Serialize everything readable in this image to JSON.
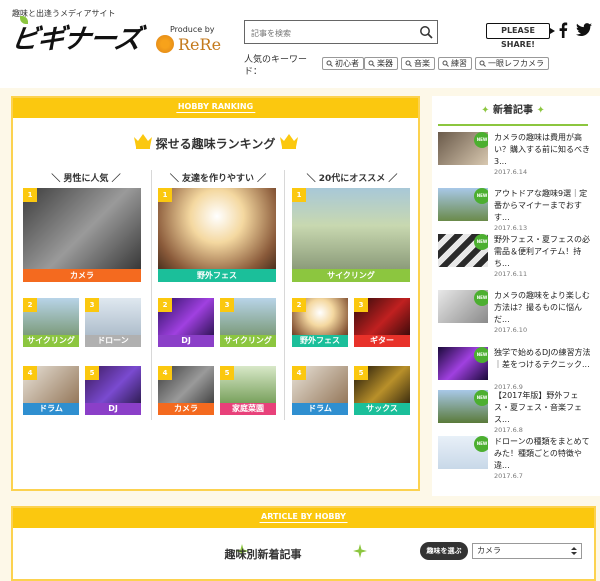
{
  "header": {
    "tagline": "趣味と出逢うメディアサイト",
    "logo": "ビギナーズ",
    "produce_by": "Produce by",
    "rere": "ReRe",
    "search_placeholder": "記事を検索",
    "keyword_label": "人気のキーワード：",
    "keywords": [
      "初心者",
      "楽器",
      "音楽",
      "練習",
      "一眼レフカメラ"
    ],
    "share": "PLEASE SHARE!"
  },
  "ranking": {
    "section_label": "HOBBY RANKING",
    "title": "探せる趣味ランキング",
    "columns": [
      {
        "heading": "＼ 男性に人気 ／",
        "items": [
          {
            "rank": "1",
            "label": "カメラ",
            "color": "#f46a1f"
          },
          {
            "rank": "2",
            "label": "サイクリング",
            "color": "#8cc63f"
          },
          {
            "rank": "3",
            "label": "ドローン",
            "color": "#b0b0b0"
          },
          {
            "rank": "4",
            "label": "ドラム",
            "color": "#2f8fd0"
          },
          {
            "rank": "5",
            "label": "DJ",
            "color": "#8b3fc8"
          }
        ]
      },
      {
        "heading": "＼ 友達を作りやすい ／",
        "items": [
          {
            "rank": "1",
            "label": "野外フェス",
            "color": "#1bbf9a"
          },
          {
            "rank": "2",
            "label": "DJ",
            "color": "#8b3fc8"
          },
          {
            "rank": "3",
            "label": "サイクリング",
            "color": "#8cc63f"
          },
          {
            "rank": "4",
            "label": "カメラ",
            "color": "#f46a1f"
          },
          {
            "rank": "5",
            "label": "家庭菜園",
            "color": "#e8417a"
          }
        ]
      },
      {
        "heading": "＼ 20代にオススメ ／",
        "items": [
          {
            "rank": "1",
            "label": "サイクリング",
            "color": "#8cc63f"
          },
          {
            "rank": "2",
            "label": "野外フェス",
            "color": "#1bbf9a"
          },
          {
            "rank": "3",
            "label": "ギター",
            "color": "#e8322a"
          },
          {
            "rank": "4",
            "label": "ドラム",
            "color": "#2f8fd0"
          },
          {
            "rank": "5",
            "label": "サックス",
            "color": "#1bbf9a"
          }
        ]
      }
    ]
  },
  "sidebar": {
    "heading": "新着記事",
    "new_badge": "NEW",
    "items": [
      {
        "title": "カメラの趣味は費用が高い？購入する前に知るべき3...",
        "date": "2017.6.14"
      },
      {
        "title": "アウトドアな趣味9選｜定番からマイナーまでおすす...",
        "date": "2017.6.13"
      },
      {
        "title": "野外フェス・夏フェスの必需品＆便利アイテム！持ち...",
        "date": "2017.6.11"
      },
      {
        "title": "カメラの趣味をより楽しむ方法は？撮るものに悩んだ...",
        "date": "2017.6.10"
      },
      {
        "title": "独学で始めるDJの練習方法｜差をつけるテクニック...",
        "date": "2017.6.9"
      },
      {
        "title": "【2017年版】野外フェス・夏フェス・音楽フェス...",
        "date": "2017.6.8"
      },
      {
        "title": "ドローンの種類をまとめてみた！種類ごとの特徴や違...",
        "date": "2017.6.7"
      }
    ]
  },
  "article": {
    "section_label": "ARTICLE BY HOBBY",
    "title": "趣味別新着記事",
    "pick_label": "趣味を選ぶ",
    "selected": "カメラ"
  },
  "colors": {
    "accent": "#fbc80f",
    "green": "#8cc63f",
    "background": "#fdf8e8"
  }
}
